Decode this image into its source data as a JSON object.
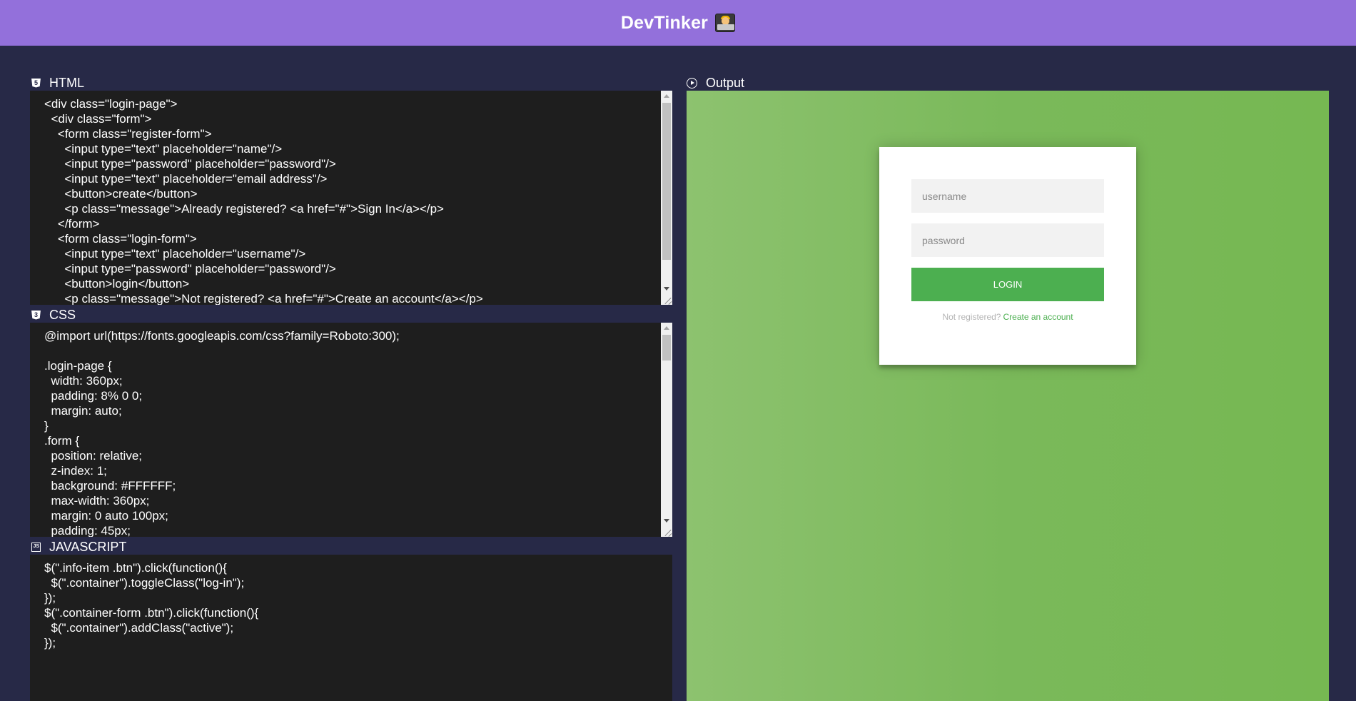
{
  "app": {
    "title": "DevTinker",
    "logo_icon": "technologist-emoji-icon"
  },
  "colors": {
    "topbar": "#9370DB",
    "background": "#272947",
    "editor_bg": "#1e1e1e",
    "output_gradient": [
      "#8dc26f",
      "#76b852"
    ],
    "accent_green": "#4CAF50"
  },
  "panels": {
    "html": {
      "label": "HTML",
      "icon": "html5-icon",
      "lines": [
        "<div class=\"login-page\">",
        "  <div class=\"form\">",
        "    <form class=\"register-form\">",
        "      <input type=\"text\" placeholder=\"name\"/>",
        "      <input type=\"password\" placeholder=\"password\"/>",
        "      <input type=\"text\" placeholder=\"email address\"/>",
        "      <button>create</button>",
        "      <p class=\"message\">Already registered? <a href=\"#\">Sign In</a></p>",
        "    </form>",
        "    <form class=\"login-form\">",
        "      <input type=\"text\" placeholder=\"username\"/>",
        "      <input type=\"password\" placeholder=\"password\"/>",
        "      <button>login</button>",
        "      <p class=\"message\">Not registered? <a href=\"#\">Create an account</a></p>"
      ]
    },
    "css": {
      "label": "CSS",
      "icon": "css3-icon",
      "lines": [
        "@import url(https://fonts.googleapis.com/css?family=Roboto:300);",
        "",
        ".login-page {",
        "  width: 360px;",
        "  padding: 8% 0 0;",
        "  margin: auto;",
        "}",
        ".form {",
        "  position: relative;",
        "  z-index: 1;",
        "  background: #FFFFFF;",
        "  max-width: 360px;",
        "  margin: 0 auto 100px;",
        "  padding: 45px;"
      ]
    },
    "javascript": {
      "label": "JAVASCRIPT",
      "icon": "js-file-icon",
      "lines": [
        "$(\".info-item .btn\").click(function(){",
        "  $(\".container\").toggleClass(\"log-in\");",
        "});",
        "$(\".container-form .btn\").click(function(){",
        "  $(\".container\").addClass(\"active\");",
        "});"
      ]
    },
    "output": {
      "label": "Output",
      "icon": "play-circle-icon",
      "login_form": {
        "username_placeholder": "username",
        "password_placeholder": "password",
        "button_label": "LOGIN",
        "message_text": "Not registered?",
        "message_link": "Create an account"
      }
    }
  }
}
